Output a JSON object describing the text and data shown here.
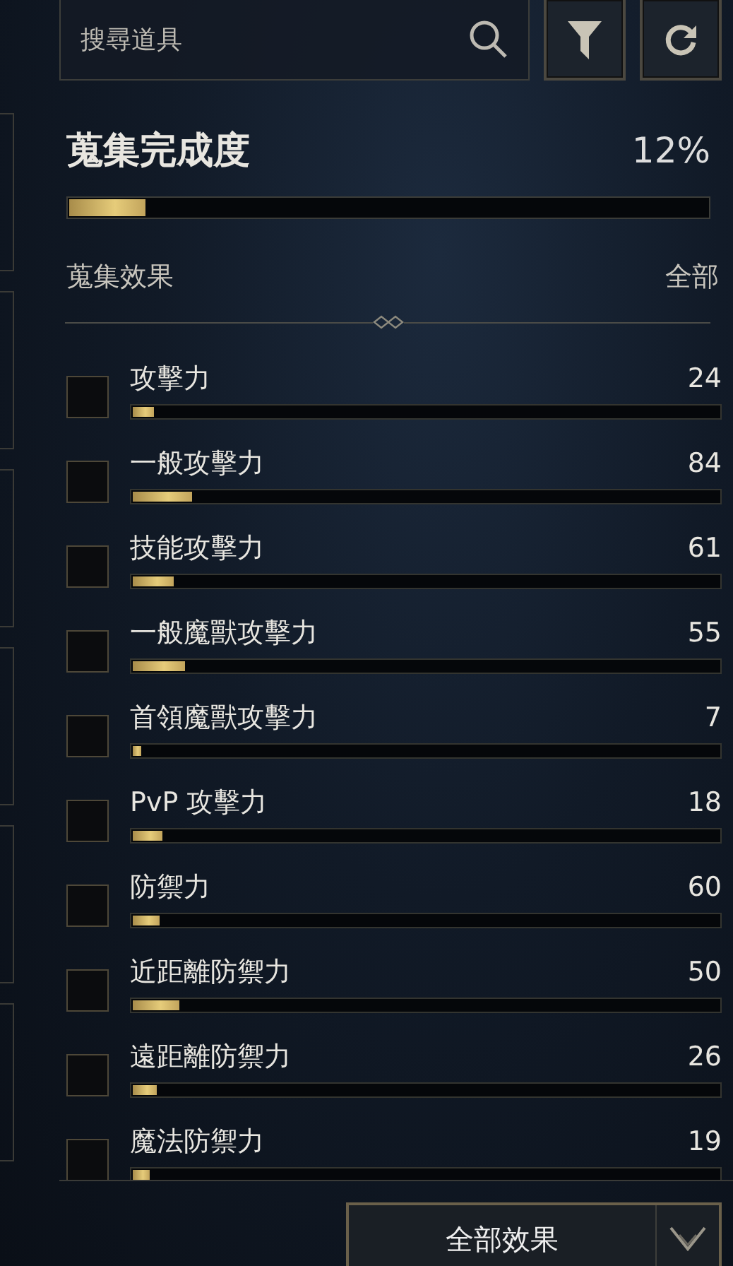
{
  "search": {
    "placeholder": "搜尋道具"
  },
  "progress": {
    "title": "蒐集完成度",
    "percent": "12%",
    "level": 0.12
  },
  "effects_header": {
    "title": "蒐集效果",
    "filter": "全部"
  },
  "effects": [
    {
      "name": "攻擊力",
      "value": "24",
      "checked": false,
      "level": 0.035
    },
    {
      "name": "一般攻擊力",
      "value": "84",
      "checked": false,
      "level": 0.1
    },
    {
      "name": "技能攻擊力",
      "value": "61",
      "checked": false,
      "level": 0.07
    },
    {
      "name": "一般魔獸攻擊力",
      "value": "55",
      "checked": false,
      "level": 0.09
    },
    {
      "name": "首領魔獸攻擊力",
      "value": "7",
      "checked": false,
      "level": 0.015
    },
    {
      "name": "PvP 攻擊力",
      "value": "18",
      "checked": false,
      "level": 0.05
    },
    {
      "name": "防禦力",
      "value": "60",
      "checked": false,
      "level": 0.045
    },
    {
      "name": "近距離防禦力",
      "value": "50",
      "checked": false,
      "level": 0.08
    },
    {
      "name": "遠距離防禦力",
      "value": "26",
      "checked": false,
      "level": 0.04
    },
    {
      "name": "魔法防禦力",
      "value": "19",
      "checked": false,
      "level": 0.03
    }
  ],
  "bottom_button": {
    "label": "全部效果"
  }
}
